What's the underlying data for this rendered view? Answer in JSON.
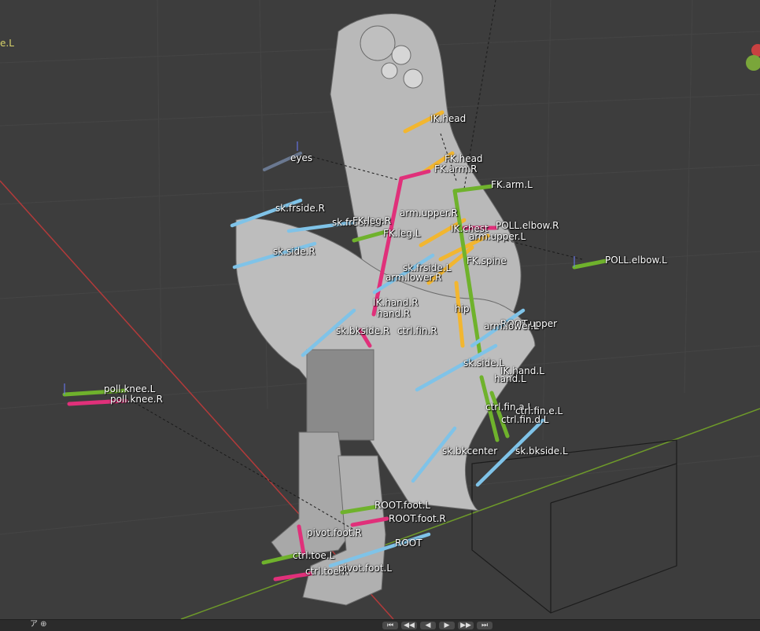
{
  "viewport": {
    "corner_label": "e.L",
    "bones": [
      {
        "name": "eyes",
        "color": "#6a7890"
      },
      {
        "name": "IK.head",
        "color": "#f2b630"
      },
      {
        "name": "FK.head",
        "color": "#f2b630"
      },
      {
        "name": "FK.arm.R",
        "color": "#e0307a"
      },
      {
        "name": "FK.arm.L",
        "color": "#6fb22c"
      },
      {
        "name": "sk.frside.R",
        "color": "#7fc3e8"
      },
      {
        "name": "sk.frcenter",
        "color": "#7fc3e8"
      },
      {
        "name": "FK.leg.R",
        "color": "#e0307a"
      },
      {
        "name": "FK.leg.L",
        "color": "#6fb22c"
      },
      {
        "name": "arm.upper.R",
        "color": "#f2b630"
      },
      {
        "name": "IK.chest",
        "color": "#f2b630"
      },
      {
        "name": "POLL.elbow.R",
        "color": "#e0307a"
      },
      {
        "name": "arm.upper.L",
        "color": "#f2b630"
      },
      {
        "name": "POLL.elbow.L",
        "color": "#6fb22c"
      },
      {
        "name": "sk.side.R",
        "color": "#7fc3e8"
      },
      {
        "name": "FK.spine",
        "color": "#f2b630"
      },
      {
        "name": "sk.frside.L",
        "color": "#7fc3e8"
      },
      {
        "name": "arm.lower.R",
        "color": "#f2b630"
      },
      {
        "name": "IK.hand.R",
        "color": "#e0307a"
      },
      {
        "name": "hand.R",
        "color": "#e0307a"
      },
      {
        "name": "hip",
        "color": "#f2b630"
      },
      {
        "name": "ROOT.upper",
        "color": "#7fc3e8"
      },
      {
        "name": "arm.lower.L",
        "color": "#f2b630"
      },
      {
        "name": "sk.bkside.R",
        "color": "#7fc3e8"
      },
      {
        "name": "ctrl.fin.R",
        "color": "#e0307a"
      },
      {
        "name": "sk.side.L",
        "color": "#7fc3e8"
      },
      {
        "name": "IK.hand.L",
        "color": "#6fb22c"
      },
      {
        "name": "hand.L",
        "color": "#6fb22c"
      },
      {
        "name": "poll.knee.L",
        "color": "#6fb22c"
      },
      {
        "name": "poll.knee.R",
        "color": "#e0307a"
      },
      {
        "name": "ctrl.fin.a.L",
        "color": "#6fb22c"
      },
      {
        "name": "ctrl.fin.e.L",
        "color": "#6fb22c"
      },
      {
        "name": "ctrl.fin.d.L",
        "color": "#6fb22c"
      },
      {
        "name": "sk.bkcenter",
        "color": "#7fc3e8"
      },
      {
        "name": "sk.bkside.L",
        "color": "#7fc3e8"
      },
      {
        "name": "ROOT.foot.L",
        "color": "#6fb22c"
      },
      {
        "name": "ROOT.foot.R",
        "color": "#e0307a"
      },
      {
        "name": "pivot.foot.R",
        "color": "#e0307a"
      },
      {
        "name": "ROOT",
        "color": "#7fc3e8"
      },
      {
        "name": "ctrl.toe.L",
        "color": "#6fb22c"
      },
      {
        "name": "ctrl.toe.R",
        "color": "#e0307a"
      },
      {
        "name": "pivot.foot.L",
        "color": "#6fb22c"
      }
    ]
  },
  "footer": {
    "left_text": "ア  ⊕",
    "playback_buttons": [
      "⏮",
      "◀◀",
      "◀",
      "▶",
      "▶▶",
      "⏭"
    ]
  }
}
